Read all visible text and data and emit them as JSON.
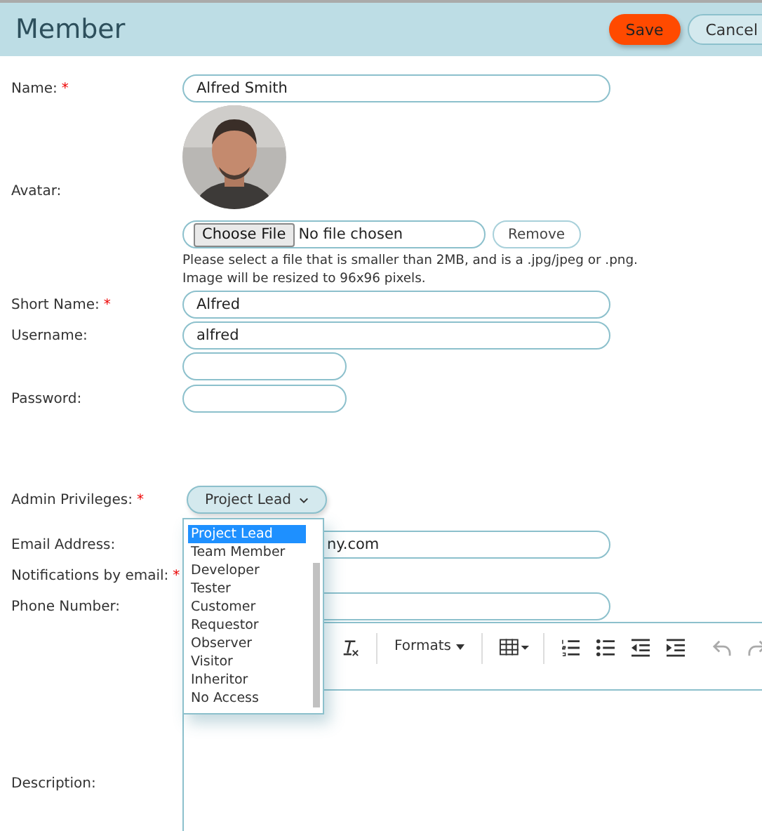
{
  "header": {
    "title": "Member",
    "buttons": [
      {
        "label": "Save",
        "kind": "primary"
      },
      {
        "label": "Cancel",
        "kind": "secondary"
      }
    ]
  },
  "fields": [
    {
      "label": "Name:",
      "required_mark": "*",
      "kind": "text",
      "value": "Alfred Smith"
    },
    {
      "label": "Avatar:",
      "kind": "avatar",
      "file_button": "Choose File",
      "file_status": "No file chosen",
      "remove_button": "Remove",
      "help": [
        "Please select a file that is smaller than 2MB, and is a .jpg/jpeg or .png.",
        "Image will be resized to 96x96 pixels."
      ]
    },
    {
      "label": "Short Name:",
      "required_mark": "*",
      "kind": "text",
      "value": "Alfred"
    },
    {
      "label": "Username:",
      "kind": "text",
      "value": "alfred"
    },
    {
      "label": "Password:",
      "kind": "password"
    },
    {
      "label": "Admin Privileges:",
      "required_mark": "*",
      "kind": "select",
      "value": "Project Lead",
      "expanded": true,
      "options": [
        {
          "label": "Project Lead",
          "selected": true
        },
        {
          "label": "Team Member",
          "selected": false
        },
        {
          "label": "Developer",
          "selected": false
        },
        {
          "label": "Tester",
          "selected": false
        },
        {
          "label": "Customer",
          "selected": false
        },
        {
          "label": "Requestor",
          "selected": false
        },
        {
          "label": "Observer",
          "selected": false
        },
        {
          "label": "Visitor",
          "selected": false
        },
        {
          "label": "Inheritor",
          "selected": false
        },
        {
          "label": "No Access",
          "selected": false
        }
      ]
    },
    {
      "label": "Email Address:",
      "kind": "covered-text",
      "value": "ny.com"
    },
    {
      "label": "Notifications by email:",
      "required_mark": "*",
      "kind": "hidden"
    },
    {
      "label": "Phone Number:",
      "kind": "text"
    },
    {
      "label": "Description:",
      "kind": "editor",
      "formats_label": "Formats"
    }
  ]
}
